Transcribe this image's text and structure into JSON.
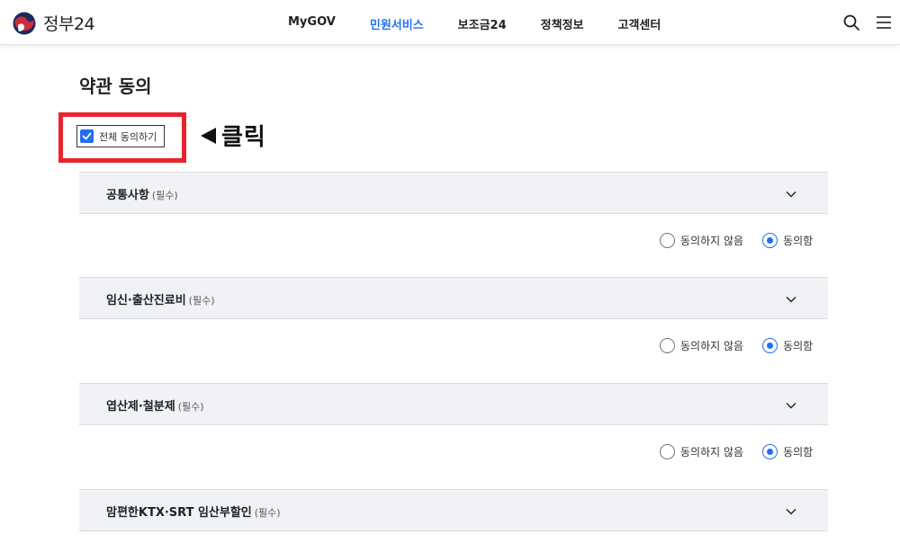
{
  "header": {
    "logo_text": "정부24",
    "nav": [
      "MyGOV",
      "민원서비스",
      "보조금24",
      "정책정보",
      "고객센터"
    ],
    "active_nav_index": 1,
    "icons": [
      "search-icon",
      "menu-icon"
    ]
  },
  "page": {
    "title": "약관 동의",
    "agree_all_label": "전체 동의하기",
    "agree_all_checked": true,
    "annotation": "클릭"
  },
  "sections": [
    {
      "title": "공통사항",
      "required": "(필수)",
      "option_no": "동의하지 않음",
      "option_yes": "동의함",
      "selected": "yes"
    },
    {
      "title": "임신·출산진료비",
      "required": "(필수)",
      "option_no": "동의하지 않음",
      "option_yes": "동의함",
      "selected": "yes"
    },
    {
      "title": "엽산제·철분제",
      "required": "(필수)",
      "option_no": "동의하지 않음",
      "option_yes": "동의함",
      "selected": "yes"
    },
    {
      "title": "맘편한KTX·SRT 임산부할인",
      "required": "(필수)"
    }
  ],
  "colors": {
    "accent": "#256ef4",
    "highlight": "#e8242e",
    "section_bg": "#f0f2f5"
  }
}
